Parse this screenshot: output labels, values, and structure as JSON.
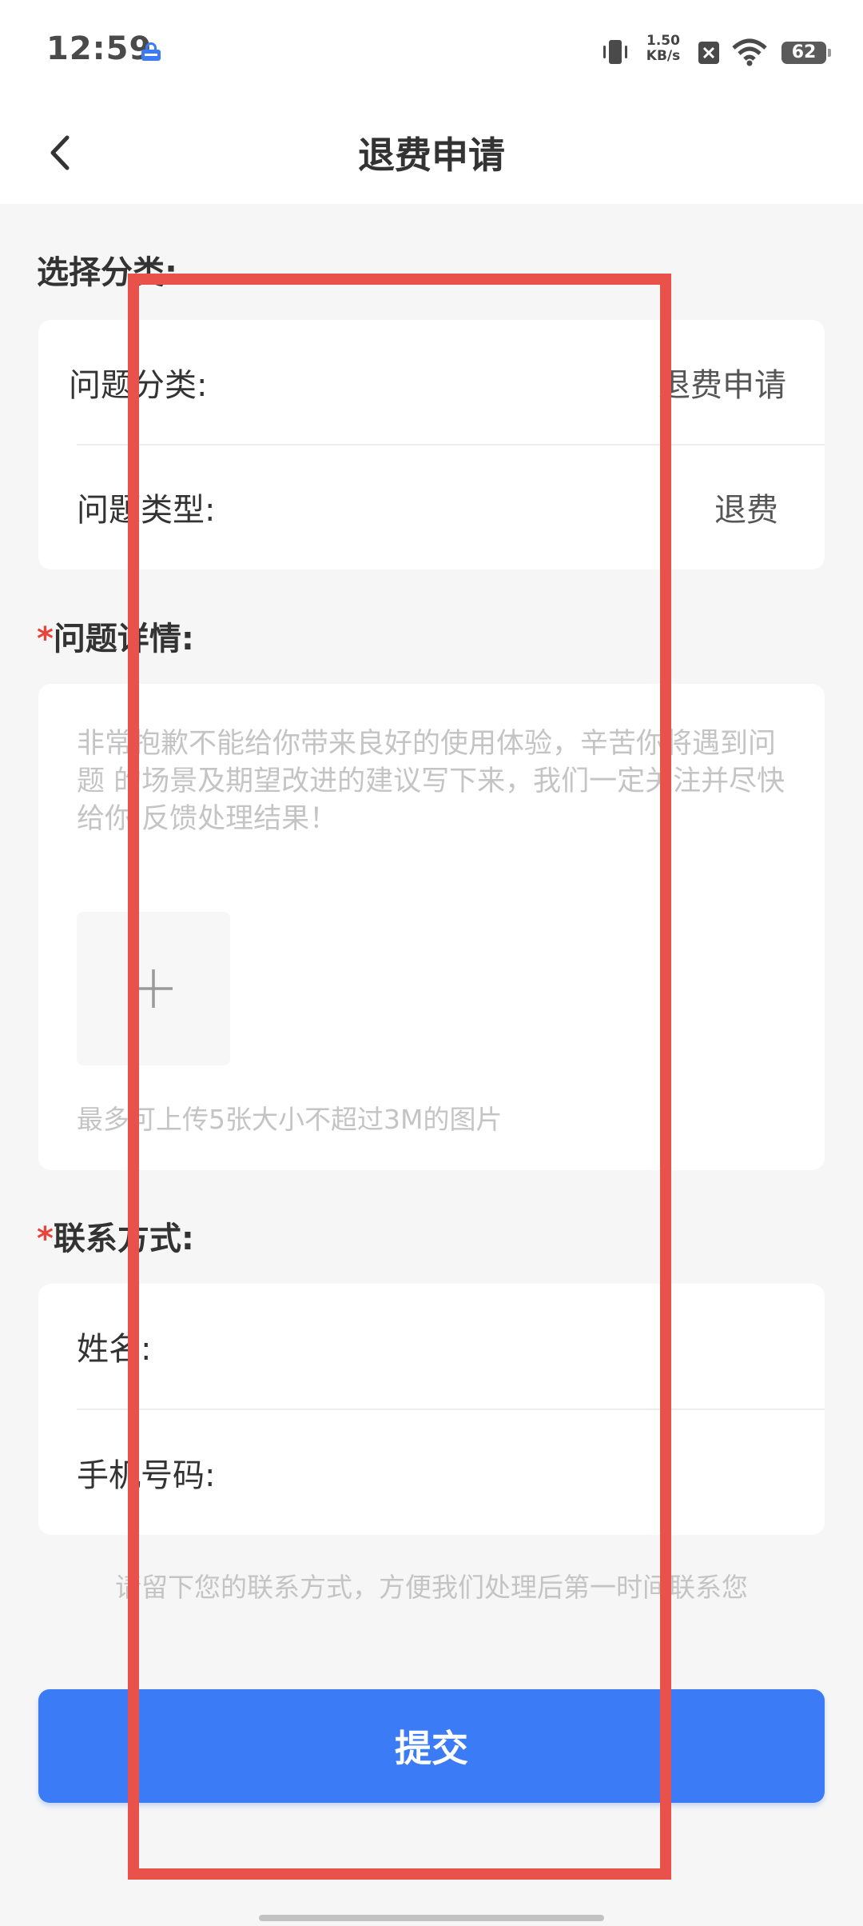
{
  "status_bar": {
    "time": "12:59",
    "net_speed_value": "1.50",
    "net_speed_unit": "KB/s",
    "battery": "62"
  },
  "nav": {
    "title": "退费申请"
  },
  "category_section": {
    "title": "选择分类:",
    "rows": [
      {
        "label": "问题分类:",
        "value": "退费申请"
      },
      {
        "label": "问题类型:",
        "value": "退费"
      }
    ]
  },
  "detail_section": {
    "required_mark": "*",
    "title": "问题详情:",
    "placeholder": "非常抱歉不能给你带来良好的使用体验，辛苦你将遇到问题 的场景及期望改进的建议写下来，我们一定关注并尽快给你 反馈处理结果！",
    "upload_hint": "最多可上传5张大小不超过3M的图片"
  },
  "contact_section": {
    "required_mark": "*",
    "title": "联系方式:",
    "rows": [
      {
        "label": "姓名:",
        "value": ""
      },
      {
        "label": "手机号码:",
        "value": ""
      }
    ],
    "hint": "请留下您的联系方式，方便我们处理后第一时间联系您"
  },
  "submit": {
    "label": "提交"
  },
  "colors": {
    "accent": "#3b7bf6",
    "required": "#e8443b",
    "highlight_box": "#e8524a"
  }
}
